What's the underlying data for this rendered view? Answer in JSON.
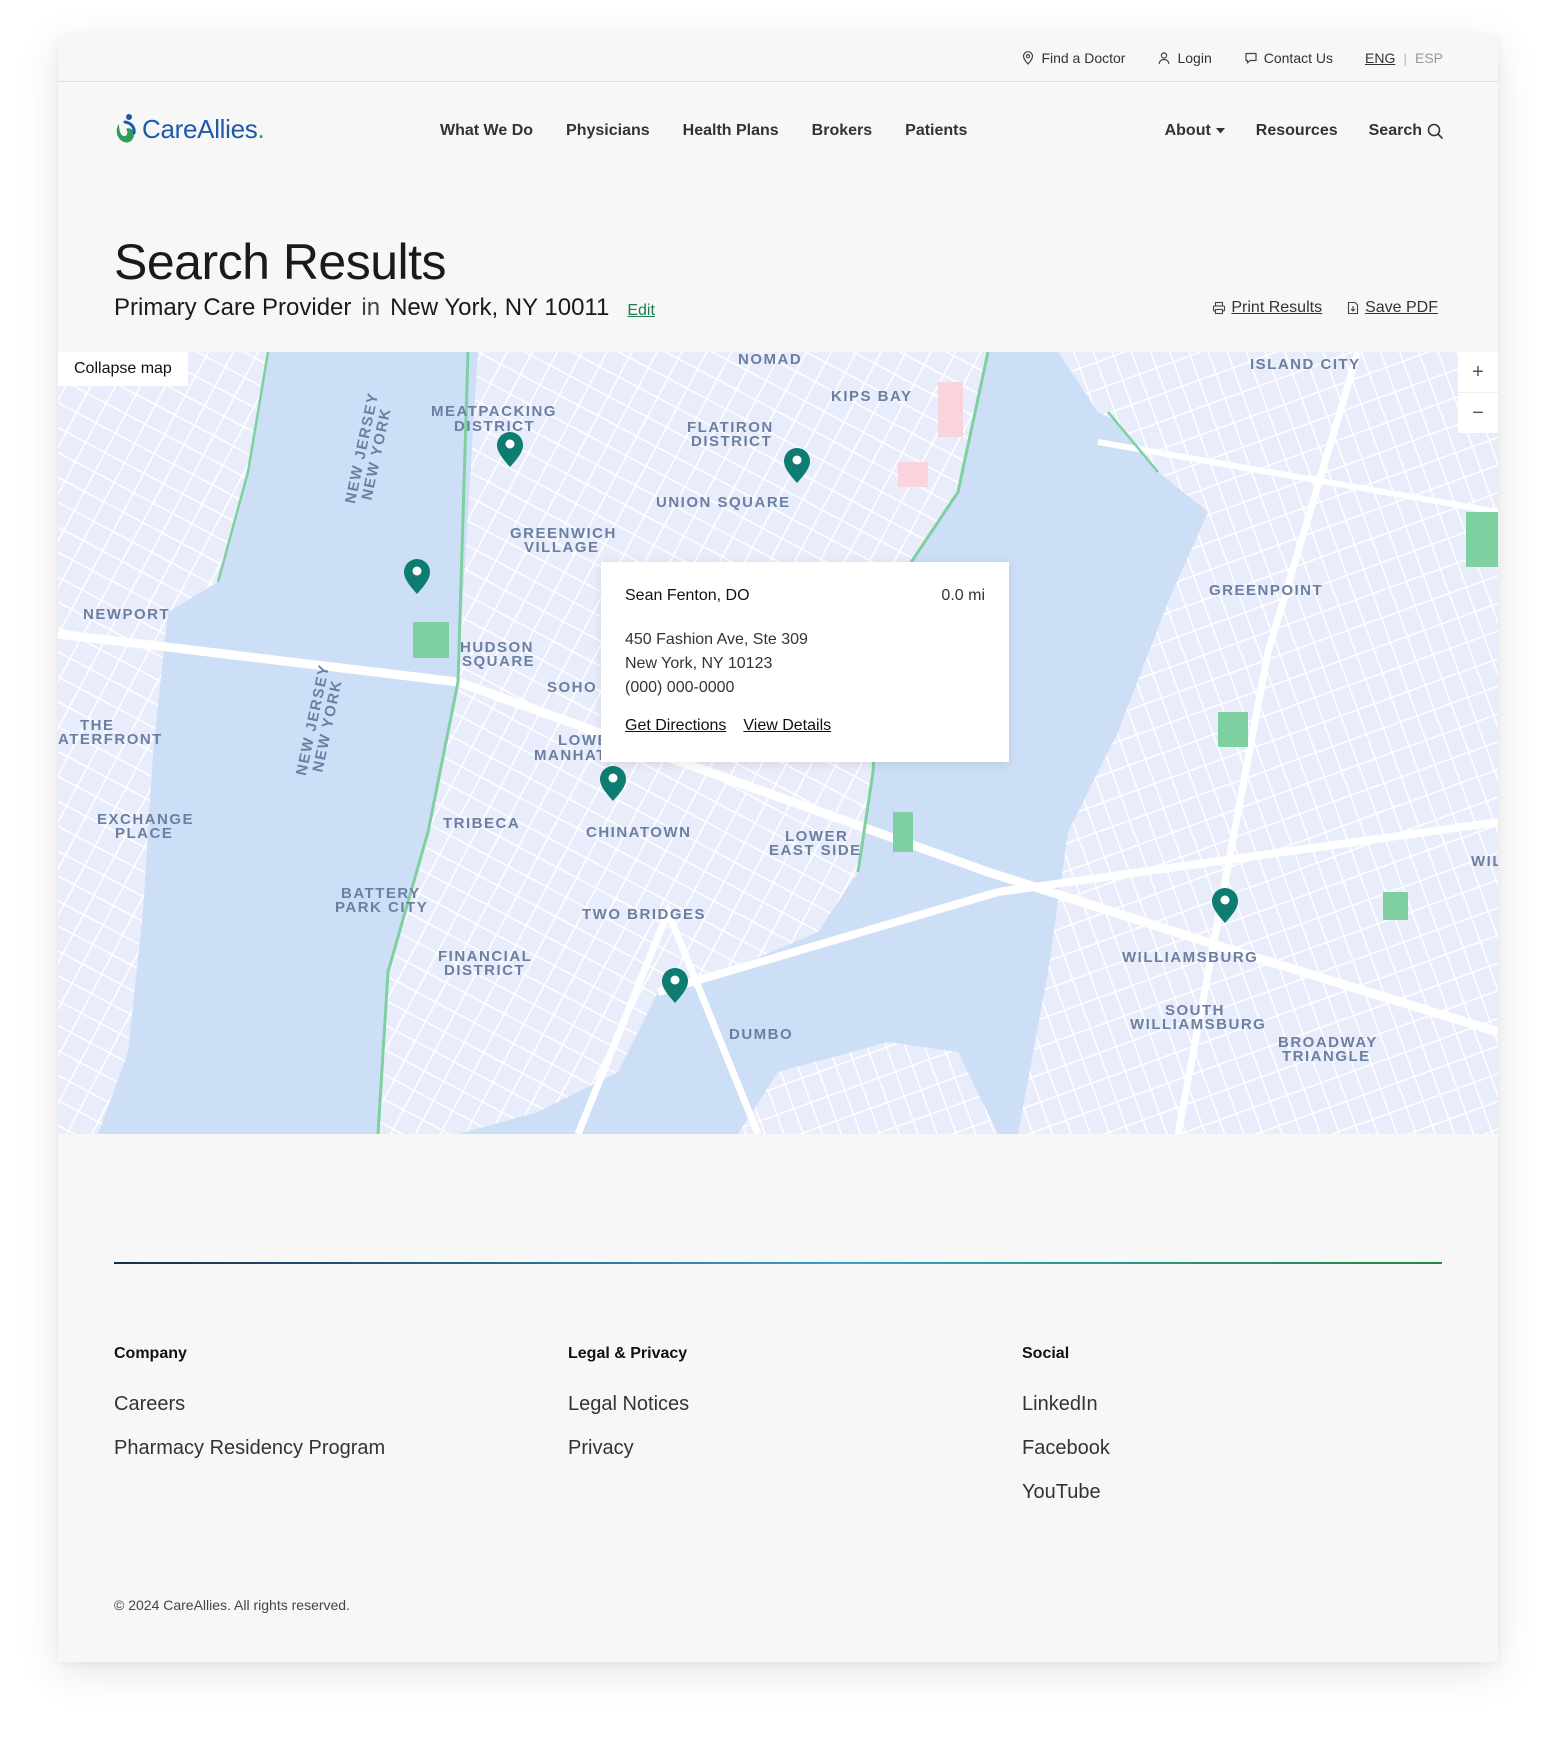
{
  "utility": {
    "find_doctor": "Find a Doctor",
    "login": "Login",
    "contact": "Contact Us",
    "lang_active": "ENG",
    "lang_sep": "|",
    "lang_inactive": "ESP"
  },
  "brand": {
    "name": "CareAllies",
    "dot": "."
  },
  "nav": {
    "items": [
      "What We Do",
      "Physicians",
      "Health Plans",
      "Brokers",
      "Patients"
    ],
    "about": "About",
    "resources": "Resources",
    "search": "Search"
  },
  "heading": {
    "title": "Search Results",
    "specialty": "Primary Care Provider",
    "in": "in",
    "location": "New York, NY 10011",
    "edit": "Edit",
    "print": "Print Results",
    "save": "Save PDF"
  },
  "map": {
    "collapse": "Collapse map",
    "zoom_in": "+",
    "zoom_out": "−",
    "labels": [
      "NOMAD",
      "KIPS BAY",
      "ISLAND CITY",
      "MEATPACKING",
      "DISTRICT",
      "FLATIRON",
      "DISTRICT",
      "UNION SQUARE",
      "GREENWICH",
      "VILLAGE",
      "GREENPOINT",
      "NEWPORT",
      "HUDSON",
      "SQUARE",
      "SOHO",
      "LOWE",
      "MANHATTAN",
      "THE",
      "ATERFRONT",
      "EXCHANGE",
      "PLACE",
      "TRIBECA",
      "CHINATOWN",
      "LOWER",
      "EAST SIDE",
      "BATTERY",
      "PARK CITY",
      "TWO BRIDGES",
      "FINANCIAL",
      "DISTRICT",
      "WILLIAMSBURG",
      "SOUTH",
      "WILLIAMSBURG",
      "DUMBO",
      "BROADWAY",
      "TRIANGLE",
      "WIL",
      "NEW JERSEY",
      "NEW YORK",
      "NEW JERSEY",
      "NEW YORK"
    ],
    "popup": {
      "name": "Sean Fenton, DO",
      "distance": "0.0 mi",
      "address1": "450 Fashion Ave, Ste 309",
      "address2": "New York, NY 10123",
      "phone": "(000) 000-0000",
      "directions": "Get Directions",
      "details": "View Details"
    },
    "pin_color": "#0e7c70"
  },
  "footer": {
    "company": {
      "title": "Company",
      "links": [
        "Careers",
        "Pharmacy Residency Program"
      ]
    },
    "legal": {
      "title": "Legal & Privacy",
      "links": [
        "Legal Notices",
        "Privacy"
      ]
    },
    "social": {
      "title": "Social",
      "links": [
        "LinkedIn",
        "Facebook",
        "YouTube"
      ]
    },
    "copyright": "© 2024 CareAllies. All rights reserved."
  }
}
